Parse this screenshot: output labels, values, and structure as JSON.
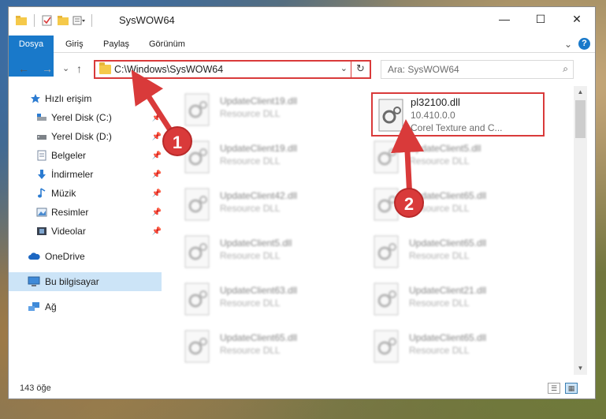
{
  "window": {
    "title": "SysWOW64",
    "minimize": "—",
    "maximize": "☐",
    "close": "✕"
  },
  "ribbon": {
    "tabs": [
      "Dosya",
      "Giriş",
      "Paylaş",
      "Görünüm"
    ],
    "expand": "⌄",
    "help": "?"
  },
  "nav": {
    "back": "←",
    "forward": "→",
    "recent": "⌄",
    "up": "↑",
    "address_path": "C:\\Windows\\SysWOW64",
    "address_dropdown": "⌄",
    "refresh": "↻",
    "search_placeholder": "Ara: SysWOW64",
    "search_icon": "⌕"
  },
  "sidebar": {
    "items": [
      {
        "label": "Hızlı erişim",
        "icon": "star-icon",
        "pinned": false
      },
      {
        "label": "Yerel Disk (C:)",
        "icon": "drive-icon",
        "pinned": true
      },
      {
        "label": "Yerel Disk (D:)",
        "icon": "drive-icon",
        "pinned": true
      },
      {
        "label": "Belgeler",
        "icon": "documents-icon",
        "pinned": true
      },
      {
        "label": "İndirmeler",
        "icon": "download-icon",
        "pinned": true
      },
      {
        "label": "Müzik",
        "icon": "music-icon",
        "pinned": true
      },
      {
        "label": "Resimler",
        "icon": "pictures-icon",
        "pinned": true
      },
      {
        "label": "Videolar",
        "icon": "video-icon",
        "pinned": true
      },
      {
        "label": "OneDrive",
        "icon": "cloud-icon",
        "pinned": false
      },
      {
        "label": "Bu bilgisayar",
        "icon": "computer-icon",
        "pinned": false
      },
      {
        "label": "Ağ",
        "icon": "network-icon",
        "pinned": false
      }
    ],
    "pin_glyph": "📌"
  },
  "files": {
    "left": [
      {
        "name": "UpdateClient19.dll",
        "desc": "Resource DLL"
      },
      {
        "name": "UpdateClient19.dll",
        "desc": "Resource DLL"
      },
      {
        "name": "UpdateClient42.dll",
        "desc": "Resource DLL"
      },
      {
        "name": "UpdateClient5.dll",
        "desc": "Resource DLL"
      },
      {
        "name": "UpdateClient63.dll",
        "desc": "Resource DLL"
      },
      {
        "name": "UpdateClient65.dll",
        "desc": "Resource DLL"
      }
    ],
    "right": [
      {
        "name": "UpdateClient5.dll",
        "desc": "Resource DLL"
      },
      {
        "name": "UpdateClient65.dll",
        "desc": "Resource DLL"
      },
      {
        "name": "UpdateClient65.dll",
        "desc": "Resource DLL"
      },
      {
        "name": "UpdateClient21.dll",
        "desc": "Resource DLL"
      },
      {
        "name": "UpdateClient65.dll",
        "desc": "Resource DLL"
      }
    ],
    "selected": {
      "name": "pl32100.dll",
      "version": "10.410.0.0",
      "desc": "Corel Texture and C..."
    }
  },
  "status": {
    "count": "143 öğe"
  },
  "annotations": {
    "step1": "1",
    "step2": "2",
    "color": "#d93a3a"
  }
}
